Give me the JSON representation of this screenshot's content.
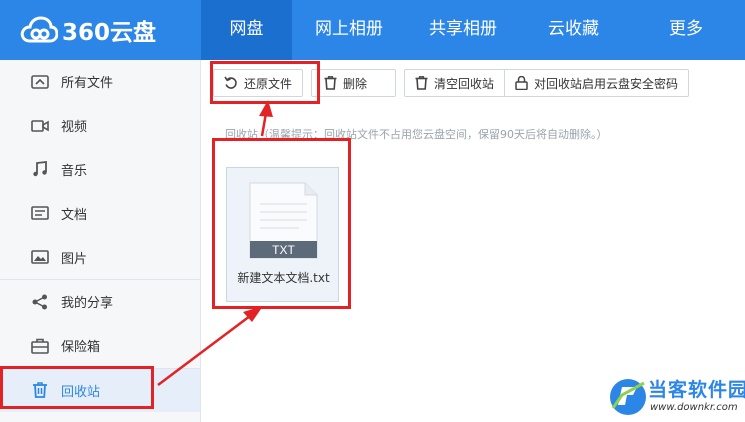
{
  "app": {
    "logo_text": "360云盘"
  },
  "nav": {
    "items": [
      {
        "label": "网盘"
      },
      {
        "label": "网上相册"
      },
      {
        "label": "共享相册"
      },
      {
        "label": "云收藏"
      },
      {
        "label": "更多"
      }
    ],
    "active_index": 0
  },
  "sidebar": {
    "items": [
      {
        "label": "所有文件",
        "icon": "all-files-icon"
      },
      {
        "label": "视频",
        "icon": "video-icon"
      },
      {
        "label": "音乐",
        "icon": "music-icon"
      },
      {
        "label": "文档",
        "icon": "document-icon"
      },
      {
        "label": "图片",
        "icon": "image-icon"
      },
      {
        "label": "我的分享",
        "icon": "share-icon"
      },
      {
        "label": "保险箱",
        "icon": "safe-box-icon"
      },
      {
        "label": "回收站",
        "icon": "trash-icon"
      }
    ],
    "active_label": "回收站"
  },
  "toolbar": {
    "restore_label": "还原文件",
    "delete_label": "删除",
    "empty_label": "清空回收站",
    "password_label": "对回收站启用云盘安全密码"
  },
  "notice": {
    "text": "回收站（温馨提示：回收站文件不占用您云盘空间，保留90天后将自动删除。）"
  },
  "files": [
    {
      "name": "新建文本文档.txt",
      "type_label": "TXT"
    }
  ],
  "watermark": {
    "title": "当客软件园",
    "url": "www.downkr.com"
  },
  "colors": {
    "brand": "#2c86e8",
    "brand_dark": "#1b6fcf",
    "annotation": "#e32225"
  }
}
